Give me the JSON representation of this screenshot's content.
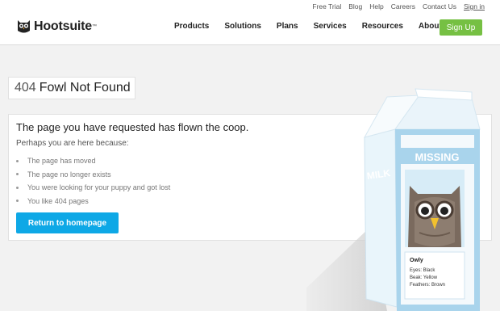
{
  "header": {
    "brand": "Hootsuite",
    "brand_mark": "™",
    "utility_nav": [
      "Free Trial",
      "Blog",
      "Help",
      "Careers",
      "Contact Us",
      "Sign in"
    ],
    "main_nav": [
      "Products",
      "Solutions",
      "Plans",
      "Services",
      "Resources",
      "About Us"
    ],
    "signup_label": "Sign Up"
  },
  "title": {
    "code": "404",
    "text": "Fowl Not Found"
  },
  "content": {
    "heading": "The page you have requested has flown the coop.",
    "subheading": "Perhaps you are here because:",
    "reasons": [
      "The page has moved",
      "The page no longer exists",
      "You were looking for your puppy and got lost",
      "You like 404 pages"
    ],
    "button_label": "Return to homepage"
  },
  "carton": {
    "side_label": "MILK",
    "missing_label": "MISSING",
    "name": "Owly",
    "details": [
      "Eyes: Black",
      "Beak: Yellow",
      "Feathers: Brown"
    ]
  },
  "colors": {
    "accent_green": "#76c043",
    "accent_blue": "#0ea8e6",
    "carton_blue": "#a9d4ec"
  }
}
